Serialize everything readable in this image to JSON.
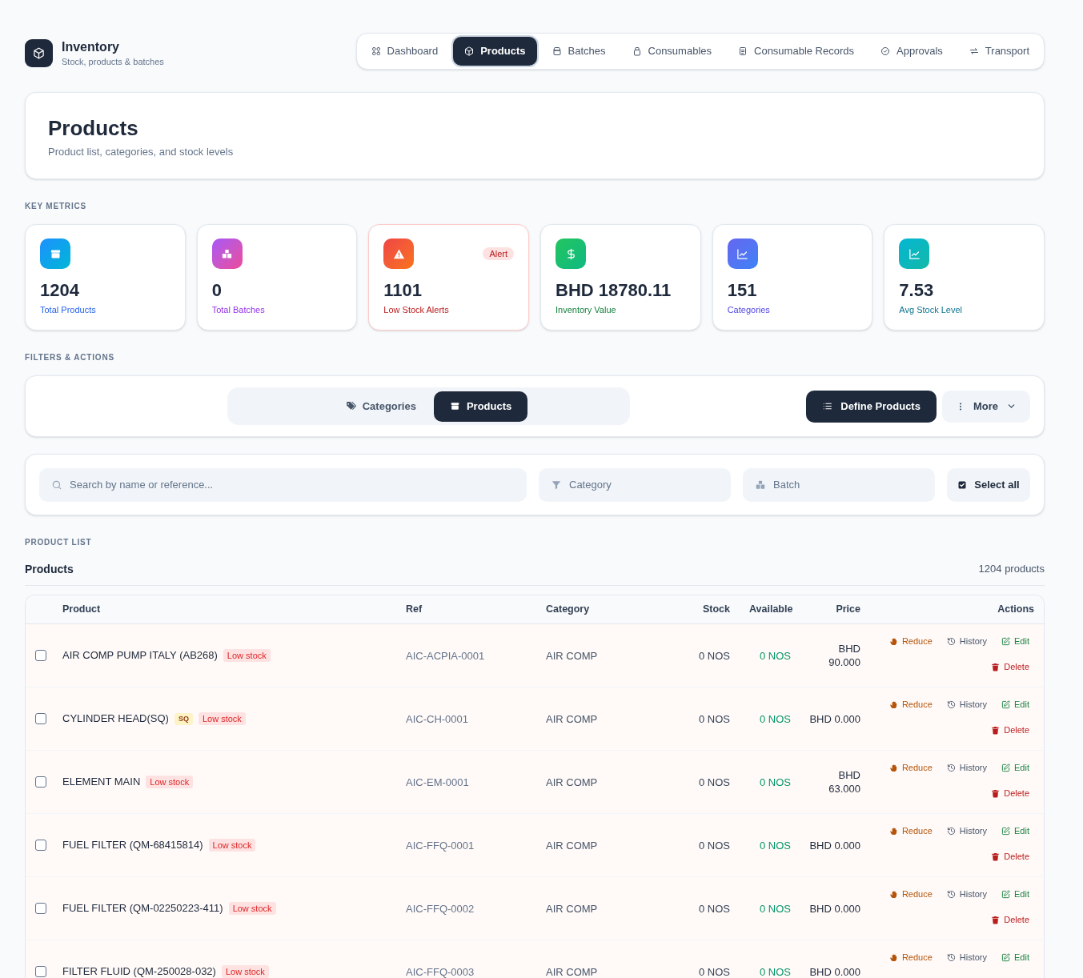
{
  "app": {
    "title": "Inventory",
    "subtitle": "Stock, products & batches"
  },
  "nav": [
    {
      "label": "Dashboard",
      "selected": false
    },
    {
      "label": "Products",
      "selected": true
    },
    {
      "label": "Batches",
      "selected": false
    },
    {
      "label": "Consumables",
      "selected": false
    },
    {
      "label": "Consumable Records",
      "selected": false
    },
    {
      "label": "Approvals",
      "selected": false
    },
    {
      "label": "Transport",
      "selected": false
    }
  ],
  "page_header": {
    "title": "Products",
    "subtitle": "Product list, categories, and stock levels"
  },
  "metrics_section": {
    "heading": "KEY METRICS",
    "metrics": [
      {
        "kind": "products",
        "value": "1204",
        "label": "Total Products",
        "color": "#2563eb",
        "highlighted": false
      },
      {
        "kind": "batches",
        "value": "0",
        "label": "Total Batches",
        "color": "#9333ea",
        "highlighted": false
      },
      {
        "kind": "alerts",
        "value": "1101",
        "label": "Low Stock Alerts",
        "color": "#b91c1c",
        "highlighted": true,
        "badge": "Alert"
      },
      {
        "kind": "value",
        "value": "BHD 18780.11",
        "label": "Inventory Value",
        "color": "#15803d",
        "highlighted": false
      },
      {
        "kind": "categories",
        "value": "151",
        "label": "Categories",
        "color": "#4f46e5",
        "highlighted": false
      },
      {
        "kind": "average",
        "value": "7.53",
        "label": "Avg Stock Level",
        "color": "#0e7490",
        "highlighted": false
      }
    ]
  },
  "filters_section": {
    "heading": "FILTERS & ACTIONS",
    "view_toggle": [
      {
        "label": "Categories",
        "selected": false
      },
      {
        "label": "Products",
        "selected": true
      }
    ],
    "buttons": [
      {
        "kind": "primary",
        "label": "Define Products"
      },
      {
        "kind": "menu",
        "label": "More"
      }
    ],
    "search": {
      "placeholder": "Search by name or reference..."
    },
    "category_filter": {
      "placeholder": "Category"
    },
    "batch_filter": {
      "placeholder": "Batch"
    },
    "select_all": {
      "label": "Select all"
    }
  },
  "product_list": {
    "heading": "PRODUCT LIST",
    "title": "Products",
    "count": "1204 products",
    "table": {
      "columns": [
        "Product",
        "Ref",
        "Category",
        "Stock",
        "Available",
        "Price",
        "Actions"
      ],
      "rows": [
        {
          "checked": false,
          "product": "AIR COMP PUMP ITALY (AB268)",
          "tags": [
            {
              "kind": "low_stock",
              "text": "Low stock"
            }
          ],
          "ref": "AIC-ACPIA-0001",
          "category": "AIR COMP",
          "stock": "0 NOS",
          "available": "0 NOS",
          "price": "BHD 90.000",
          "actions": [
            {
              "kind": "reduce",
              "label": "Reduce"
            },
            {
              "kind": "history",
              "label": "History"
            },
            {
              "kind": "edit",
              "label": "Edit"
            },
            {
              "kind": "delete",
              "label": "Delete"
            }
          ]
        },
        {
          "checked": false,
          "product": "CYLINDER HEAD(SQ)",
          "tags": [
            {
              "kind": "sq",
              "text": "SQ"
            },
            {
              "kind": "low_stock",
              "text": "Low stock"
            }
          ],
          "ref": "AIC-CH-0001",
          "category": "AIR COMP",
          "stock": "0 NOS",
          "available": "0 NOS",
          "price": "BHD 0.000",
          "actions": [
            {
              "kind": "reduce",
              "label": "Reduce"
            },
            {
              "kind": "history",
              "label": "History"
            },
            {
              "kind": "edit",
              "label": "Edit"
            },
            {
              "kind": "delete",
              "label": "Delete"
            }
          ]
        },
        {
          "checked": false,
          "product": "ELEMENT MAIN",
          "tags": [
            {
              "kind": "low_stock",
              "text": "Low stock"
            }
          ],
          "ref": "AIC-EM-0001",
          "category": "AIR COMP",
          "stock": "0 NOS",
          "available": "0 NOS",
          "price": "BHD 63.000",
          "actions": [
            {
              "kind": "reduce",
              "label": "Reduce"
            },
            {
              "kind": "history",
              "label": "History"
            },
            {
              "kind": "edit",
              "label": "Edit"
            },
            {
              "kind": "delete",
              "label": "Delete"
            }
          ]
        },
        {
          "checked": false,
          "product": "FUEL FILTER (QM-68415814)",
          "tags": [
            {
              "kind": "low_stock",
              "text": "Low stock"
            }
          ],
          "ref": "AIC-FFQ-0001",
          "category": "AIR COMP",
          "stock": "0 NOS",
          "available": "0 NOS",
          "price": "BHD 0.000",
          "actions": [
            {
              "kind": "reduce",
              "label": "Reduce"
            },
            {
              "kind": "history",
              "label": "History"
            },
            {
              "kind": "edit",
              "label": "Edit"
            },
            {
              "kind": "delete",
              "label": "Delete"
            }
          ]
        },
        {
          "checked": false,
          "product": "FUEL FILTER (QM-02250223-411)",
          "tags": [
            {
              "kind": "low_stock",
              "text": "Low stock"
            }
          ],
          "ref": "AIC-FFQ-0002",
          "category": "AIR COMP",
          "stock": "0 NOS",
          "available": "0 NOS",
          "price": "BHD 0.000",
          "actions": [
            {
              "kind": "reduce",
              "label": "Reduce"
            },
            {
              "kind": "history",
              "label": "History"
            },
            {
              "kind": "edit",
              "label": "Edit"
            },
            {
              "kind": "delete",
              "label": "Delete"
            }
          ]
        },
        {
          "checked": false,
          "product": "FILTER FLUID (QM-250028-032)",
          "tags": [
            {
              "kind": "low_stock",
              "text": "Low stock"
            }
          ],
          "ref": "AIC-FFQ-0003",
          "category": "AIR COMP",
          "stock": "0 NOS",
          "available": "0 NOS",
          "price": "BHD 0.000",
          "actions": [
            {
              "kind": "reduce",
              "label": "Reduce"
            },
            {
              "kind": "history",
              "label": "History"
            },
            {
              "kind": "edit",
              "label": "Edit"
            }
          ]
        }
      ]
    }
  }
}
